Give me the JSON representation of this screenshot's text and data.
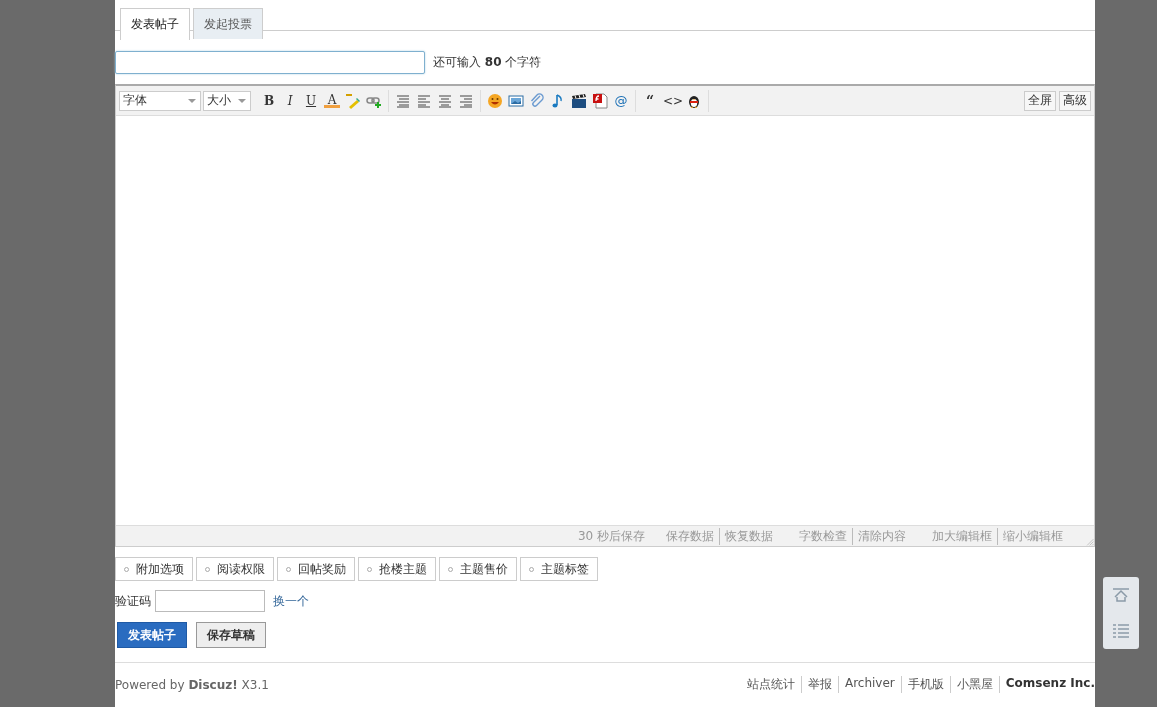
{
  "tabs": [
    {
      "label": "发表帖子",
      "selected": true
    },
    {
      "label": "发起投票",
      "selected": false
    }
  ],
  "title_field": {
    "counter": "还可输入 **80** 个字符"
  },
  "toolbar": {
    "selects": [
      "字体",
      "大小"
    ],
    "groups": [
      [
        {
          "kind": "glyph",
          "text": "B"
        },
        {
          "kind": "glyph",
          "text": "I"
        },
        {
          "kind": "glyph",
          "text": "U"
        },
        {
          "kind": "glyph",
          "text": "A"
        },
        {
          "kind": "icon"
        },
        {
          "kind": "icon"
        }
      ],
      [
        {
          "kind": "icon"
        },
        {
          "kind": "icon"
        },
        {
          "kind": "icon"
        },
        {
          "kind": "icon"
        }
      ],
      [
        {
          "kind": "icon"
        },
        {
          "kind": "icon"
        },
        {
          "kind": "icon"
        },
        {
          "kind": "icon"
        },
        {
          "kind": "icon"
        },
        {
          "kind": "icon"
        },
        {
          "kind": "glyph",
          "text": "@"
        }
      ],
      [
        {
          "kind": "glyph",
          "text": "“"
        },
        {
          "kind": "glyph",
          "text": "<>"
        },
        {
          "kind": "icon"
        }
      ]
    ],
    "right_buttons": [
      "全屏",
      "高级"
    ]
  },
  "status_bar": {
    "autosave": "30 秒后保存",
    "link_groups": [
      [
        "保存数据",
        "恢复数据"
      ],
      [
        "字数检查",
        "清除内容"
      ],
      [
        "加大编辑框",
        "缩小编辑框"
      ]
    ]
  },
  "options": [
    "附加选项",
    "阅读权限",
    "回帖奖励",
    "抢楼主题",
    "主题售价",
    "主题标签"
  ],
  "captcha": {
    "label": "验证码",
    "refresh": "换一个"
  },
  "actions": [
    {
      "label": "发表帖子",
      "kind": "primary"
    },
    {
      "label": "保存草稿",
      "kind": "secondary"
    }
  ],
  "footer": {
    "powered": "Powered by **Discuz!** X3.1",
    "links": [
      {
        "text": "站点统计",
        "strong": false
      },
      {
        "text": "举报",
        "strong": false
      },
      {
        "text": "Archiver",
        "strong": false
      },
      {
        "text": "手机版",
        "strong": false
      },
      {
        "text": "小黑屋",
        "strong": false
      },
      {
        "text": "Comsenz Inc.",
        "strong": true
      }
    ]
  }
}
